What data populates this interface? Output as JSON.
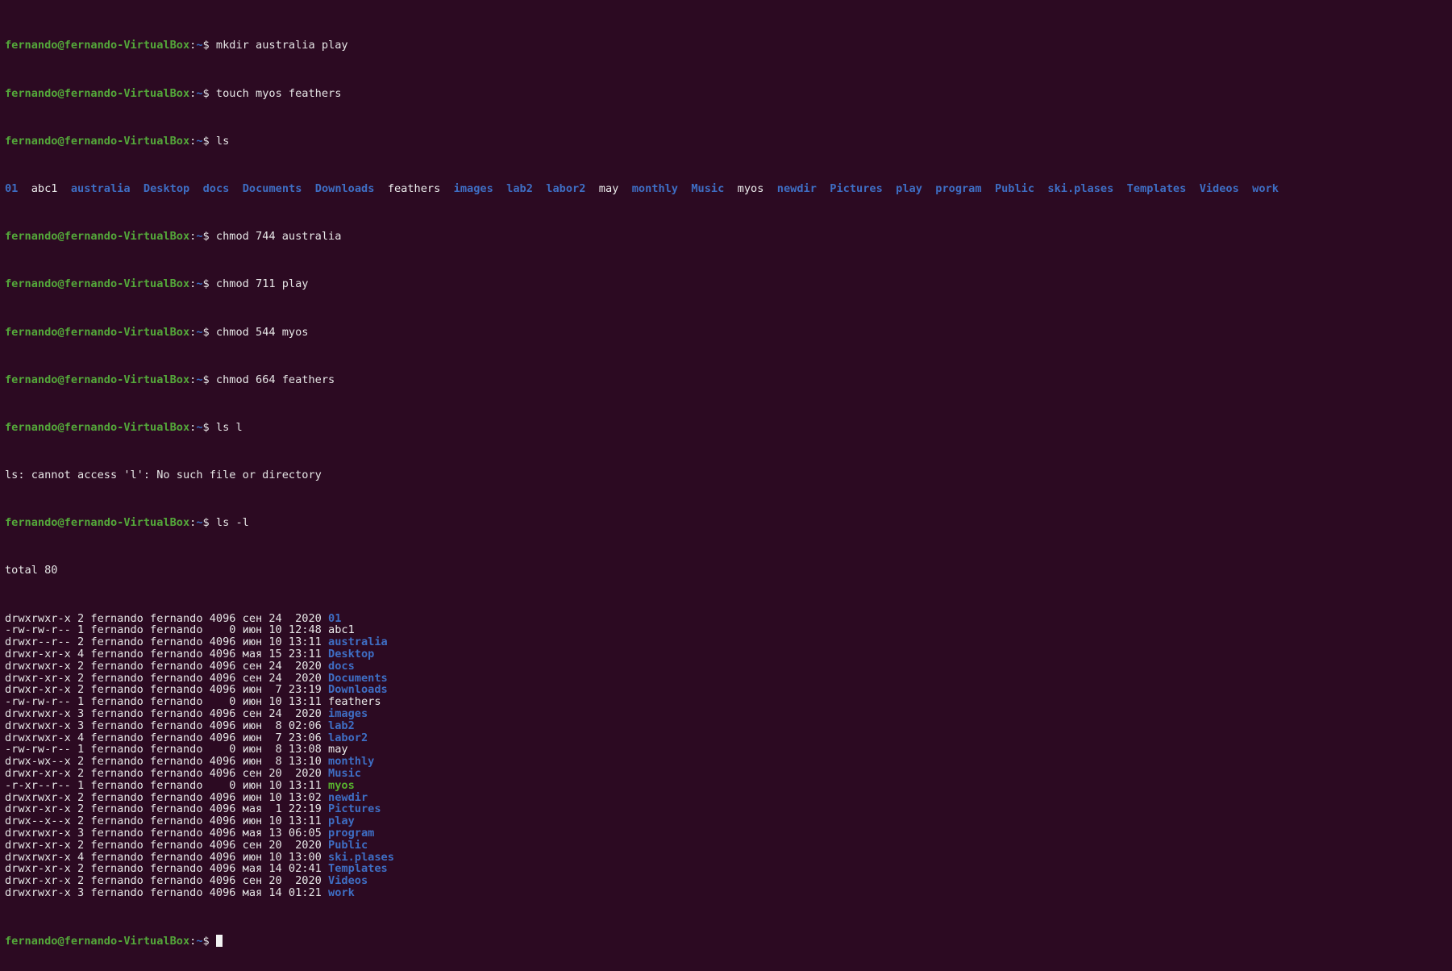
{
  "colors": {
    "background": "#2c0a22",
    "prompt_user": "#54a83a",
    "prompt_path": "#3a6fc4",
    "directory": "#3e6ec4",
    "executable": "#57b02e",
    "text": "#e6e6e6"
  },
  "prompt": {
    "user_host": "fernando@fernando-VirtualBox",
    "colon": ":",
    "path": "~",
    "symbol": "$ "
  },
  "commands": {
    "mkdir": "mkdir australia play",
    "touch": "touch myos feathers",
    "ls": "ls",
    "chmod_australia": "chmod 744 australia",
    "chmod_play": "chmod 711 play",
    "chmod_myos": "chmod 544 myos",
    "chmod_feathers": "chmod 664 feathers",
    "ls_l_bad": "ls l",
    "ls_l": "ls -l"
  },
  "ls_items": [
    {
      "name": "01",
      "type": "dir",
      "after": "  "
    },
    {
      "name": "abc1",
      "type": "file",
      "after": "  "
    },
    {
      "name": "australia",
      "type": "dir",
      "after": "  "
    },
    {
      "name": "Desktop",
      "type": "dir",
      "after": "  "
    },
    {
      "name": "docs",
      "type": "dir",
      "after": "  "
    },
    {
      "name": "Documents",
      "type": "dir",
      "after": "  "
    },
    {
      "name": "Downloads",
      "type": "dir",
      "after": "  "
    },
    {
      "name": "feathers",
      "type": "file",
      "after": "  "
    },
    {
      "name": "images",
      "type": "dir",
      "after": "  "
    },
    {
      "name": "lab2",
      "type": "dir",
      "after": "  "
    },
    {
      "name": "labor2",
      "type": "dir",
      "after": "  "
    },
    {
      "name": "may",
      "type": "file",
      "after": "  "
    },
    {
      "name": "monthly",
      "type": "dir",
      "after": "  "
    },
    {
      "name": "Music",
      "type": "dir",
      "after": "  "
    },
    {
      "name": "myos",
      "type": "file",
      "after": "  "
    },
    {
      "name": "newdir",
      "type": "dir",
      "after": "  "
    },
    {
      "name": "Pictures",
      "type": "dir",
      "after": "  "
    },
    {
      "name": "play",
      "type": "dir",
      "after": "  "
    },
    {
      "name": "program",
      "type": "dir",
      "after": "  "
    },
    {
      "name": "Public",
      "type": "dir",
      "after": "  "
    },
    {
      "name": "ski.plases",
      "type": "dir",
      "after": "  "
    },
    {
      "name": "Templates",
      "type": "dir",
      "after": "  "
    },
    {
      "name": "Videos",
      "type": "dir",
      "after": "  "
    },
    {
      "name": "work",
      "type": "dir",
      "after": ""
    }
  ],
  "error_line": "ls: cannot access 'l': No such file or directory",
  "total_line": "total 80",
  "listing": [
    {
      "meta": "drwxrwxr-x 2 fernando fernando 4096 сен 24  2020 ",
      "name": "01",
      "type": "dir"
    },
    {
      "meta": "-rw-rw-r-- 1 fernando fernando    0 июн 10 12:48 ",
      "name": "abc1",
      "type": "file"
    },
    {
      "meta": "drwxr--r-- 2 fernando fernando 4096 июн 10 13:11 ",
      "name": "australia",
      "type": "dir"
    },
    {
      "meta": "drwxr-xr-x 4 fernando fernando 4096 мая 15 23:11 ",
      "name": "Desktop",
      "type": "dir"
    },
    {
      "meta": "drwxrwxr-x 2 fernando fernando 4096 сен 24  2020 ",
      "name": "docs",
      "type": "dir"
    },
    {
      "meta": "drwxr-xr-x 2 fernando fernando 4096 сен 24  2020 ",
      "name": "Documents",
      "type": "dir"
    },
    {
      "meta": "drwxr-xr-x 2 fernando fernando 4096 июн  7 23:19 ",
      "name": "Downloads",
      "type": "dir"
    },
    {
      "meta": "-rw-rw-r-- 1 fernando fernando    0 июн 10 13:11 ",
      "name": "feathers",
      "type": "file"
    },
    {
      "meta": "drwxrwxr-x 3 fernando fernando 4096 сен 24  2020 ",
      "name": "images",
      "type": "dir"
    },
    {
      "meta": "drwxrwxr-x 3 fernando fernando 4096 июн  8 02:06 ",
      "name": "lab2",
      "type": "dir"
    },
    {
      "meta": "drwxrwxr-x 4 fernando fernando 4096 июн  7 23:06 ",
      "name": "labor2",
      "type": "dir"
    },
    {
      "meta": "-rw-rw-r-- 1 fernando fernando    0 июн  8 13:08 ",
      "name": "may",
      "type": "file"
    },
    {
      "meta": "drwx-wx--x 2 fernando fernando 4096 июн  8 13:10 ",
      "name": "monthly",
      "type": "dir"
    },
    {
      "meta": "drwxr-xr-x 2 fernando fernando 4096 сен 20  2020 ",
      "name": "Music",
      "type": "dir"
    },
    {
      "meta": "-r-xr--r-- 1 fernando fernando    0 июн 10 13:11 ",
      "name": "myos",
      "type": "exe"
    },
    {
      "meta": "drwxrwxr-x 2 fernando fernando 4096 июн 10 13:02 ",
      "name": "newdir",
      "type": "dir"
    },
    {
      "meta": "drwxr-xr-x 2 fernando fernando 4096 мая  1 22:19 ",
      "name": "Pictures",
      "type": "dir"
    },
    {
      "meta": "drwx--x--x 2 fernando fernando 4096 июн 10 13:11 ",
      "name": "play",
      "type": "dir"
    },
    {
      "meta": "drwxrwxr-x 3 fernando fernando 4096 мая 13 06:05 ",
      "name": "program",
      "type": "dir"
    },
    {
      "meta": "drwxr-xr-x 2 fernando fernando 4096 сен 20  2020 ",
      "name": "Public",
      "type": "dir"
    },
    {
      "meta": "drwxrwxr-x 4 fernando fernando 4096 июн 10 13:00 ",
      "name": "ski.plases",
      "type": "dir"
    },
    {
      "meta": "drwxr-xr-x 2 fernando fernando 4096 мая 14 02:41 ",
      "name": "Templates",
      "type": "dir"
    },
    {
      "meta": "drwxr-xr-x 2 fernando fernando 4096 сен 20  2020 ",
      "name": "Videos",
      "type": "dir"
    },
    {
      "meta": "drwxrwxr-x 3 fernando fernando 4096 мая 14 01:21 ",
      "name": "work",
      "type": "dir"
    }
  ]
}
